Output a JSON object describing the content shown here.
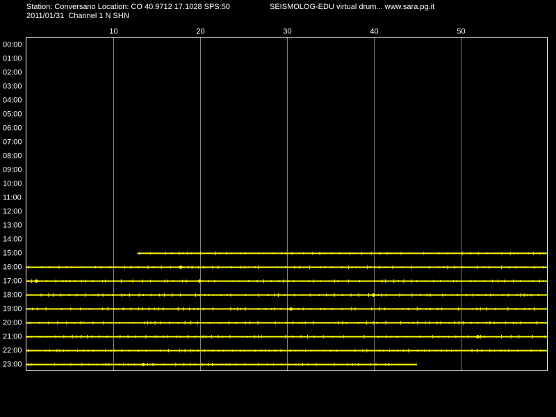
{
  "header": {
    "station_line": "Station: Conversano Location: CO 40.9712 17.1028 SPS:50",
    "app_title": "SEISMOLOG-EDU virtual drum... www.sara.pg.it",
    "date_line": "2011/01/31  Channel 1 N SHN"
  },
  "colors": {
    "background": "#000000",
    "frame": "#ffffff",
    "grid": "#808080",
    "trace": "#ffff00",
    "text": "#ffffff"
  },
  "chart_data": {
    "type": "line",
    "title": "",
    "xlabel": "",
    "ylabel": "",
    "x_ticks": [
      "10",
      "20",
      "30",
      "40",
      "50"
    ],
    "x_tick_values": [
      10,
      20,
      30,
      40,
      50
    ],
    "xlim": [
      0,
      60
    ],
    "y_labels": [
      "00:00",
      "01:00",
      "02:00",
      "03:00",
      "04:00",
      "05:00",
      "06:00",
      "07:00",
      "08:00",
      "09:00",
      "10:00",
      "11:00",
      "12:00",
      "13:00",
      "14:00",
      "15:00",
      "16:00",
      "17:00",
      "18:00",
      "19:00",
      "20:00",
      "21:00",
      "22:00",
      "23:00"
    ],
    "grid": true,
    "traces": [
      {
        "hour": "15:00",
        "start_min": 12.8,
        "end_min": 60
      },
      {
        "hour": "16:00",
        "start_min": 0,
        "end_min": 60
      },
      {
        "hour": "17:00",
        "start_min": 0,
        "end_min": 60
      },
      {
        "hour": "18:00",
        "start_min": 0,
        "end_min": 60
      },
      {
        "hour": "19:00",
        "start_min": 0,
        "end_min": 60
      },
      {
        "hour": "20:00",
        "start_min": 0,
        "end_min": 60
      },
      {
        "hour": "21:00",
        "start_min": 0,
        "end_min": 60
      },
      {
        "hour": "22:00",
        "start_min": 0,
        "end_min": 60
      },
      {
        "hour": "23:00",
        "start_min": 0,
        "end_min": 45
      }
    ],
    "events": [
      {
        "hour": "17:00",
        "minute": 20
      },
      {
        "hour": "17:00",
        "minute": 1.2
      },
      {
        "hour": "16:00",
        "minute": 17.8
      },
      {
        "hour": "18:00",
        "minute": 40
      },
      {
        "hour": "19:00",
        "minute": 30.5
      },
      {
        "hour": "21:00",
        "minute": 52
      },
      {
        "hour": "23:00",
        "minute": 13.5
      }
    ]
  }
}
